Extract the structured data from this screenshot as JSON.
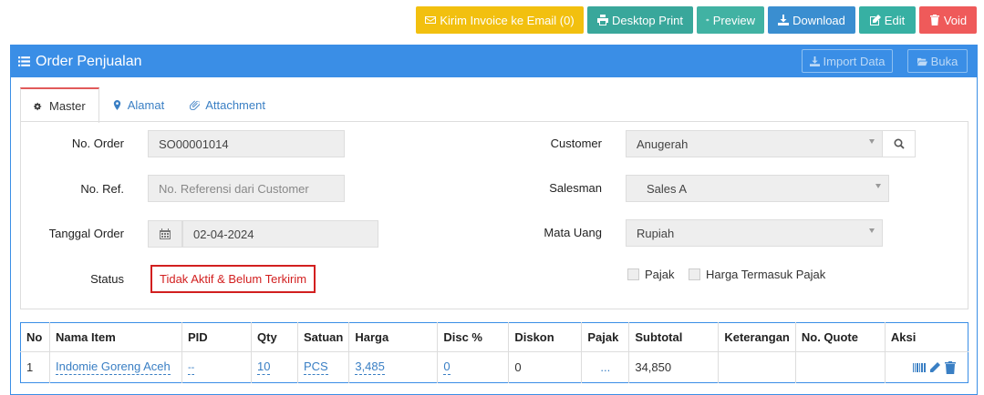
{
  "toolbar": {
    "email_label": "Kirim Invoice ke Email (0)",
    "print_label": "Desktop Print",
    "preview_label": "Preview",
    "download_label": "Download",
    "edit_label": "Edit",
    "void_label": "Void"
  },
  "panel": {
    "title": "Order Penjualan",
    "import_label": "Import Data",
    "buka_label": "Buka"
  },
  "tabs": [
    {
      "label": "Master"
    },
    {
      "label": "Alamat"
    },
    {
      "label": "Attachment"
    }
  ],
  "form": {
    "no_order_label": "No. Order",
    "no_order_value": "SO00001014",
    "no_ref_label": "No. Ref.",
    "no_ref_placeholder": "No. Referensi dari Customer",
    "tanggal_label": "Tanggal Order",
    "tanggal_value": "02-04-2024",
    "status_label": "Status",
    "status_value": "Tidak Aktif & Belum Terkirim",
    "customer_label": "Customer",
    "customer_value": "Anugerah",
    "salesman_label": "Salesman",
    "salesman_value": "Sales A",
    "mata_uang_label": "Mata Uang",
    "mata_uang_value": "Rupiah",
    "pajak_label": "Pajak",
    "harga_pajak_label": "Harga Termasuk Pajak"
  },
  "table": {
    "headers": [
      "No",
      "Nama Item",
      "PID",
      "Qty",
      "Satuan",
      "Harga",
      "Disc %",
      "Diskon",
      "Pajak",
      "Subtotal",
      "Keterangan",
      "No. Quote",
      "Aksi"
    ],
    "rows": [
      {
        "no": "1",
        "nama_item": "Indomie Goreng Aceh",
        "pid": "--",
        "qty": "10",
        "satuan": "PCS",
        "harga": "3,485",
        "disc": "0",
        "diskon": "0",
        "pajak": "...",
        "subtotal": "34,850",
        "keterangan": "",
        "no_quote": ""
      }
    ]
  },
  "colors": {
    "primary": "#3a8ee6",
    "email": "#f2c00f",
    "print": "#39a79b",
    "preview": "#41b2a3",
    "download": "#3a8ed0",
    "edit": "#37b0a3",
    "void": "#ef5a5a",
    "status_red": "#d21f1f"
  }
}
